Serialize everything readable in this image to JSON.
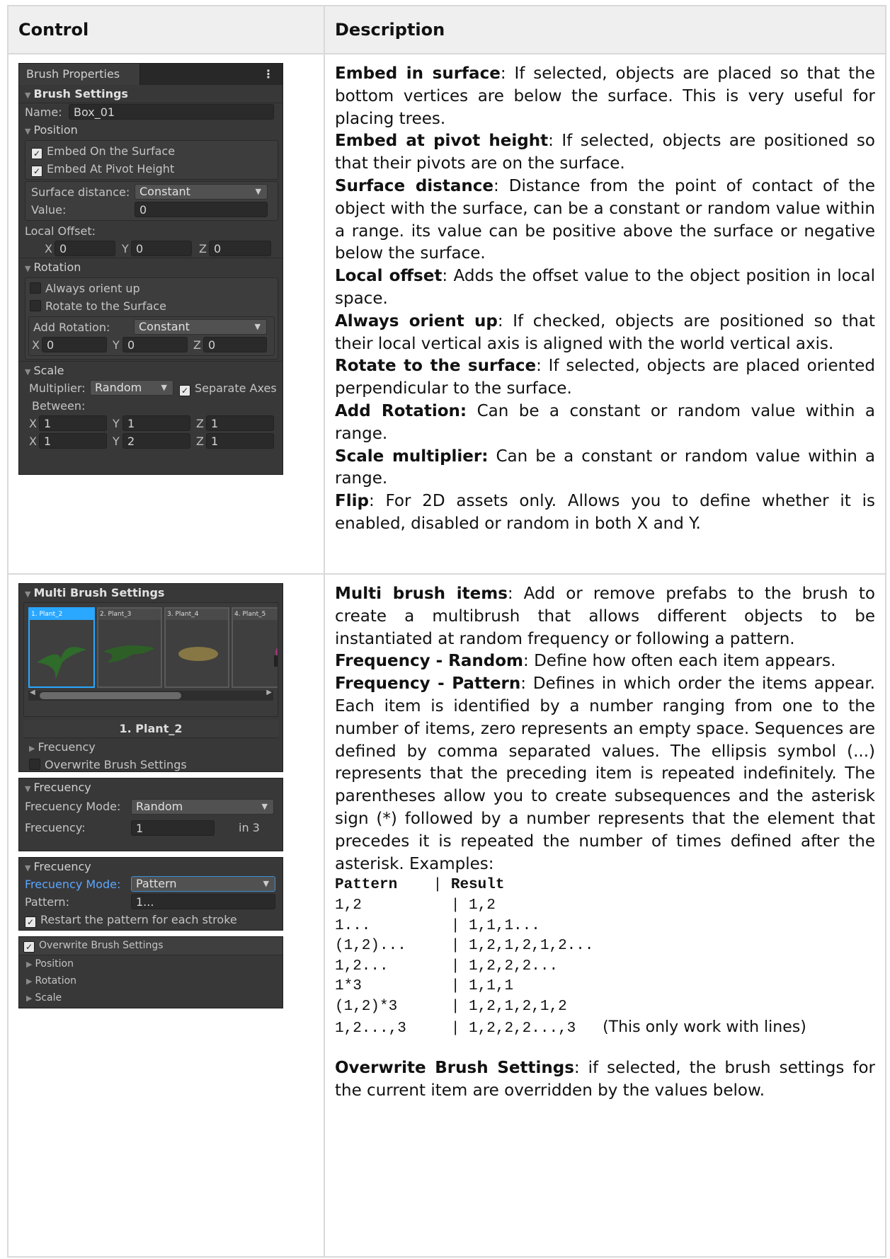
{
  "table": {
    "header_control": "Control",
    "header_description": "Description"
  },
  "brush_panel": {
    "tab": "Brush Properties",
    "settings": "Brush Settings",
    "name_label": "Name:",
    "name_value": "Box_01",
    "position": "Position",
    "embed_surface": "Embed On the Surface",
    "embed_pivot": "Embed At Pivot Height",
    "surface_distance": "Surface distance:",
    "surface_distance_mode": "Constant",
    "value_label": "Value:",
    "value": "0",
    "local_offset": "Local Offset:",
    "offset_x": "0",
    "offset_y": "0",
    "offset_z": "0",
    "rotation": "Rotation",
    "always_orient_up": "Always orient up",
    "rotate_surface": "Rotate to the Surface",
    "add_rotation": "Add Rotation:",
    "add_rotation_mode": "Constant",
    "rot_x": "0",
    "rot_y": "0",
    "rot_z": "0",
    "scale": "Scale",
    "multiplier": "Multiplier:",
    "multiplier_mode": "Random",
    "separate_axes": "Separate Axes",
    "between": "Between:",
    "min_x": "1",
    "min_y": "1",
    "min_z": "1",
    "max_x": "1",
    "max_y": "2",
    "max_z": "1",
    "axis_x": "X",
    "axis_y": "Y",
    "axis_z": "Z"
  },
  "multi_panel": {
    "title": "Multi Brush Settings",
    "thumbs": [
      "1. Plant_2",
      "2. Plant_3",
      "3. Plant_4",
      "4. Plant_5"
    ],
    "selected": "1. Plant_2",
    "frecuency": "Frecuency",
    "overwrite": "Overwrite Brush Settings"
  },
  "freq_random": {
    "title": "Frecuency",
    "mode_label": "Frecuency Mode:",
    "mode": "Random",
    "freq_label": "Frecuency:",
    "freq_value": "1",
    "in": "in 3"
  },
  "freq_pattern": {
    "title": "Frecuency",
    "mode_label": "Frecuency Mode:",
    "mode": "Pattern",
    "pattern_label": "Pattern:",
    "pattern_value": "1...",
    "restart": "Restart the pattern for each stroke"
  },
  "overwrite_panel": {
    "title": "Overwrite Brush Settings",
    "items": [
      "Position",
      "Rotation",
      "Scale"
    ]
  },
  "desc1": [
    {
      "term": "Embed in surface",
      "text": ": If selected, objects are placed so that the bottom vertices are below the surface. This is very useful for placing trees."
    },
    {
      "term": "Embed at pivot height",
      "text": ": If selected, objects are positioned so that their pivots are on the surface."
    },
    {
      "term": "Surface distance",
      "text": ": Distance from the point of contact of the object with the surface, can be a constant or random value within a range. its value can be positive above the surface or negative below the surface."
    },
    {
      "term": "Local offset",
      "text": ": Adds the offset value to the object position in local space."
    },
    {
      "term": "Always orient up",
      "text": ": If checked, objects are positioned so that their local vertical axis is aligned with the world vertical axis."
    },
    {
      "term": "Rotate to the surface",
      "text": ": If selected, objects are placed oriented perpendicular to the surface."
    },
    {
      "term": "Add Rotation:",
      "text": " Can be a constant or random value within a range."
    },
    {
      "term": "Scale multiplier:",
      "text": " Can be a constant or random value within a range."
    },
    {
      "term": "Flip",
      "text": ": For 2D assets only. Allows you to define whether it is enabled, disabled or random in both X and Y."
    }
  ],
  "desc2": [
    {
      "term": "Multi brush items",
      "text": ": Add or remove prefabs to the brush to create a multibrush that allows different objects to be instantiated at random frequency or following a pattern."
    },
    {
      "term": "Frequency - Random",
      "text": ": Define how often each item appears."
    },
    {
      "term": "Frequency - Pattern",
      "text": ": Defines in which order the items appear. Each item is identified by a number ranging from one to the number of items, zero represents an empty space. Sequences are defined by comma separated values. The ellipsis symbol (...) represents that the preceding item is repeated indefinitely. The parentheses allow you to create subsequences and the asterisk sign (*) followed by a number represents that the element that precedes it is repeated the number of times defined after the asterisk. Examples:"
    }
  ],
  "examples": {
    "head_pattern": "Pattern",
    "head_result": "Result",
    "rows": [
      {
        "p": "1,2",
        "r": "1,2",
        "note": ""
      },
      {
        "p": "1...",
        "r": "1,1,1...",
        "note": ""
      },
      {
        "p": "(1,2)...",
        "r": "1,2,1,2,1,2...",
        "note": ""
      },
      {
        "p": "1,2...",
        "r": "1,2,2,2...",
        "note": ""
      },
      {
        "p": "1*3",
        "r": "1,1,1",
        "note": ""
      },
      {
        "p": "(1,2)*3",
        "r": "1,2,1,2,1,2",
        "note": ""
      },
      {
        "p": "1,2...,3",
        "r": "1,2,2,2...,3",
        "note": "(This only work with lines)"
      }
    ]
  },
  "desc3": {
    "term": "Overwrite Brush Settings",
    "text": ": if selected, the brush settings for the current item are overridden by the values below."
  }
}
